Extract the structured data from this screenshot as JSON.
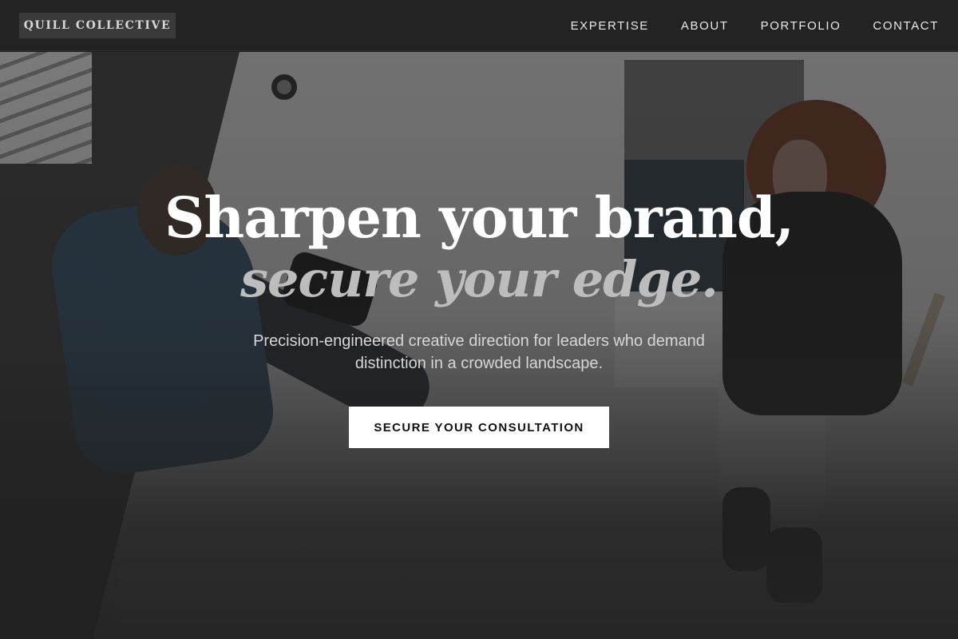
{
  "navbar": {
    "brand": "QUILL COLLECTIVE",
    "links": [
      "EXPERTISE",
      "ABOUT",
      "PORTFOLIO",
      "CONTACT"
    ]
  },
  "hero": {
    "headline_line1": "Sharpen your brand,",
    "headline_line2": "secure your edge.",
    "subtext": "Precision-engineered creative direction for leaders who demand distinction in a crowded landscape.",
    "cta_label": "SECURE YOUR CONSULTATION"
  },
  "colors": {
    "navbar_bg": "#232323",
    "brand_bg": "#3a3a3a",
    "headline": "#ffffff",
    "headline_accent": "#bdbdbd",
    "cta_bg": "#ffffff",
    "cta_text": "#111111"
  }
}
